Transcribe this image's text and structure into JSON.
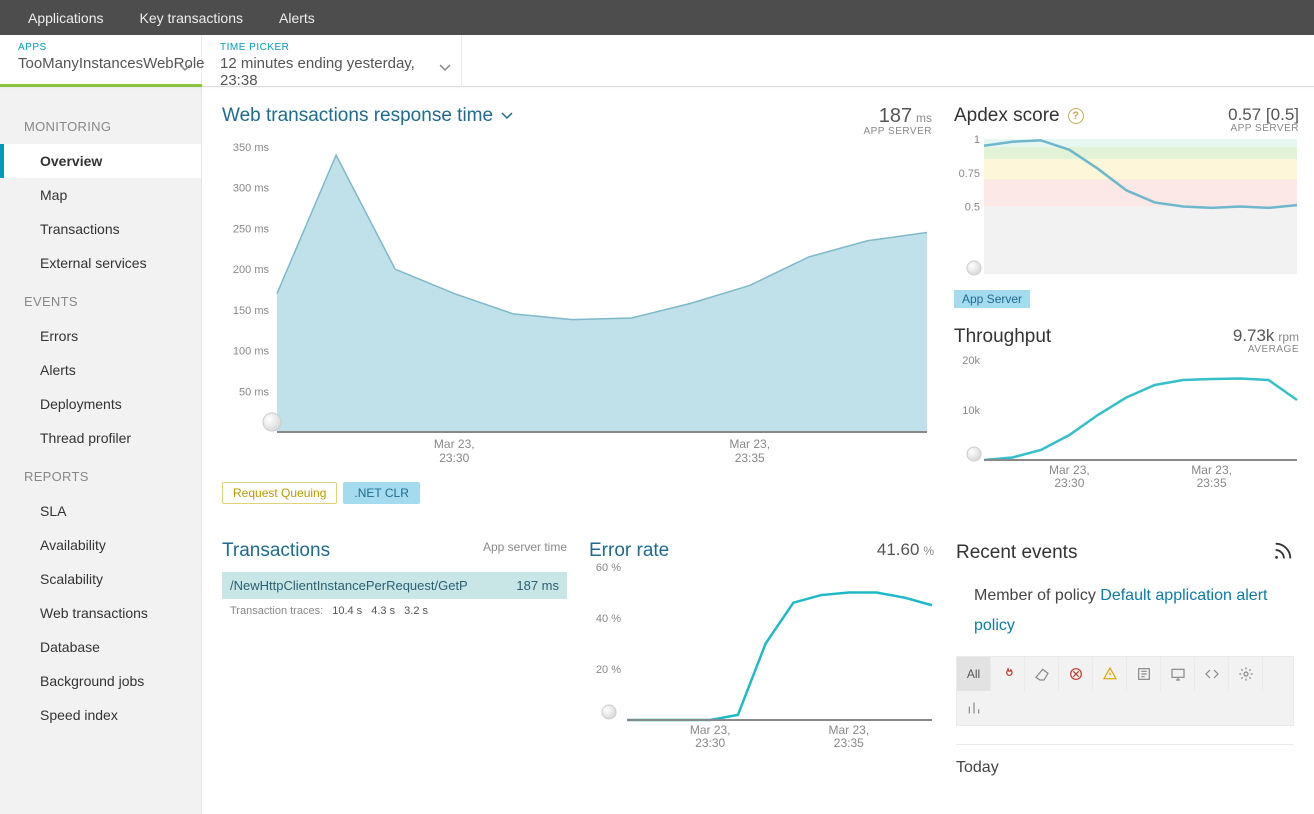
{
  "topnav": {
    "tabs": [
      "Applications",
      "Key transactions",
      "Alerts"
    ]
  },
  "pickers": {
    "apps": {
      "label": "APPS",
      "value": "TooManyInstancesWebRole"
    },
    "time": {
      "label": "TIME PICKER",
      "value": "12 minutes ending yesterday, 23:38"
    }
  },
  "sidebar": {
    "sections": [
      {
        "title": "MONITORING",
        "items": [
          "Overview",
          "Map",
          "Transactions",
          "External services"
        ],
        "active": 0
      },
      {
        "title": "EVENTS",
        "items": [
          "Errors",
          "Alerts",
          "Deployments",
          "Thread profiler"
        ]
      },
      {
        "title": "REPORTS",
        "items": [
          "SLA",
          "Availability",
          "Scalability",
          "Web transactions",
          "Database",
          "Background jobs",
          "Speed index"
        ]
      }
    ]
  },
  "responseTime": {
    "title": "Web transactions response time",
    "value": "187",
    "unit": "ms",
    "sub": "APP SERVER",
    "legend": [
      "Request Queuing",
      ".NET CLR"
    ]
  },
  "apdex": {
    "title": "Apdex score",
    "value": "0.57 [0.5]",
    "sub": "APP SERVER",
    "pill": "App Server"
  },
  "throughput": {
    "title": "Throughput",
    "value": "9.73k",
    "unit": "rpm",
    "sub": "AVERAGE"
  },
  "transactions": {
    "title": "Transactions",
    "sub": "App server time",
    "row": {
      "path": "/NewHttpClientInstancePerRequest/GetP",
      "time": "187 ms"
    },
    "traces_label": "Transaction traces:",
    "traces": [
      "10.4 s",
      "4.3 s",
      "3.2 s"
    ]
  },
  "errorRate": {
    "title": "Error rate",
    "value": "41.60",
    "unit": "%"
  },
  "recent": {
    "title": "Recent events",
    "policy_prefix": "Member of policy ",
    "policy_link": "Default application alert policy",
    "filters": {
      "all": "All"
    },
    "today": "Today"
  },
  "chart_data": [
    {
      "id": "response_time",
      "type": "area",
      "title": "Web transactions response time",
      "ylabel": "ms",
      "ylim": [
        0,
        350
      ],
      "yticks": [
        50,
        100,
        150,
        200,
        250,
        300,
        350
      ],
      "x": [
        "23:27",
        "23:28",
        "23:29",
        "23:30",
        "23:31",
        "23:32",
        "23:33",
        "23:34",
        "23:35",
        "23:36",
        "23:37",
        "23:38"
      ],
      "x_ticks": [
        "Mar 23,\n23:30",
        "Mar 23,\n23:35"
      ],
      "series": [
        {
          "name": ".NET CLR",
          "values": [
            170,
            340,
            200,
            170,
            145,
            138,
            140,
            158,
            180,
            215,
            235,
            245
          ]
        }
      ]
    },
    {
      "id": "apdex",
      "type": "line",
      "title": "Apdex score",
      "ylim": [
        0,
        1
      ],
      "yticks": [
        0.5,
        0.75,
        1
      ],
      "x": [
        "23:27",
        "23:28",
        "23:29",
        "23:30",
        "23:31",
        "23:32",
        "23:33",
        "23:34",
        "23:35",
        "23:36",
        "23:37",
        "23:38"
      ],
      "bands": [
        [
          0.94,
          1.0
        ],
        [
          0.85,
          0.94
        ],
        [
          0.7,
          0.85
        ],
        [
          0.5,
          0.7
        ],
        [
          0.0,
          0.5
        ]
      ],
      "series": [
        {
          "name": "App Server",
          "values": [
            0.95,
            0.98,
            0.99,
            0.92,
            0.78,
            0.62,
            0.53,
            0.5,
            0.49,
            0.5,
            0.49,
            0.51
          ]
        }
      ]
    },
    {
      "id": "throughput",
      "type": "line",
      "title": "Throughput",
      "ylabel": "rpm",
      "ylim": [
        0,
        20000
      ],
      "yticks": [
        10000,
        20000
      ],
      "ytick_labels": [
        "10k",
        "20k"
      ],
      "x": [
        "23:27",
        "23:28",
        "23:29",
        "23:30",
        "23:31",
        "23:32",
        "23:33",
        "23:34",
        "23:35",
        "23:36",
        "23:37",
        "23:38"
      ],
      "x_ticks": [
        "Mar 23,\n23:30",
        "Mar 23,\n23:35"
      ],
      "series": [
        {
          "name": "Throughput",
          "values": [
            0,
            500,
            2000,
            5000,
            9000,
            12500,
            15000,
            16000,
            16200,
            16300,
            16000,
            12000
          ]
        }
      ]
    },
    {
      "id": "error_rate",
      "type": "line",
      "title": "Error rate",
      "ylabel": "%",
      "ylim": [
        0,
        60
      ],
      "yticks": [
        20,
        40,
        60
      ],
      "x": [
        "23:27",
        "23:28",
        "23:29",
        "23:30",
        "23:31",
        "23:32",
        "23:33",
        "23:34",
        "23:35",
        "23:36",
        "23:37",
        "23:38"
      ],
      "x_ticks": [
        "Mar 23,\n23:30",
        "Mar 23,\n23:35"
      ],
      "series": [
        {
          "name": "Error rate",
          "values": [
            0,
            0,
            0,
            0,
            2,
            30,
            46,
            49,
            50,
            50,
            48,
            45
          ]
        }
      ]
    }
  ]
}
